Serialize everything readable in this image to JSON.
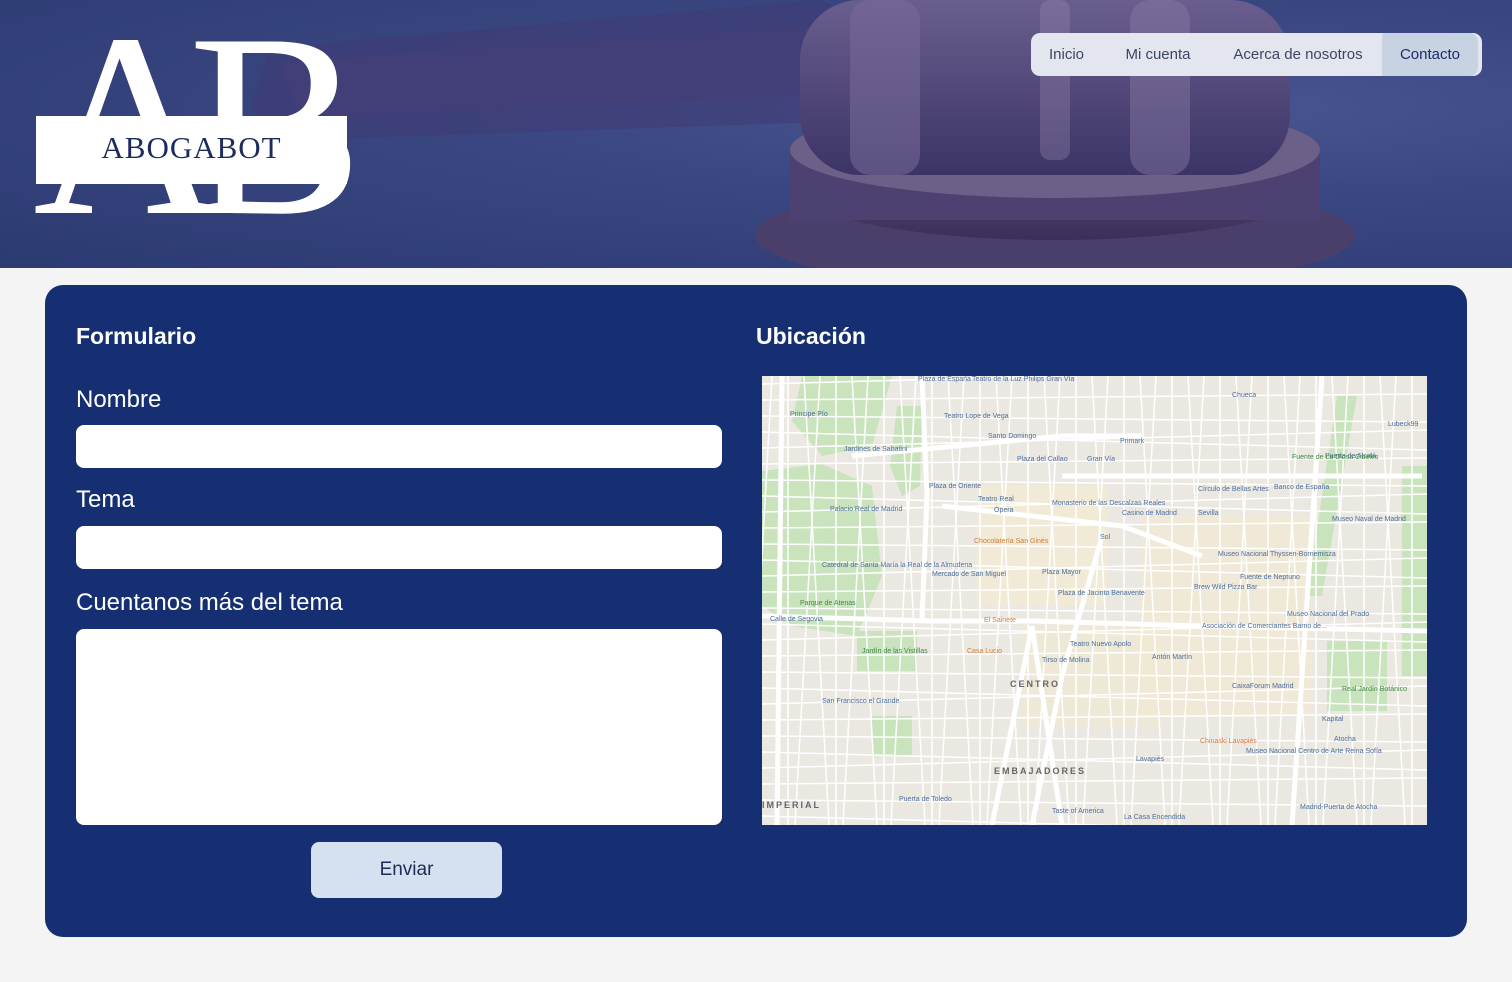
{
  "brand": {
    "monogram": "AB",
    "name": "ABOGABOT"
  },
  "nav": {
    "items": [
      {
        "label": "Inicio"
      },
      {
        "label": "Mi cuenta"
      },
      {
        "label": "Acerca de nosotros"
      },
      {
        "label": "Contacto",
        "active": true
      }
    ]
  },
  "form": {
    "title": "Formulario",
    "name_label": "Nombre",
    "name_value": "",
    "topic_label": "Tema",
    "topic_value": "",
    "details_label": "Cuentanos más del tema",
    "details_value": "",
    "submit_label": "Enviar"
  },
  "location": {
    "title": "Ubicación",
    "map_labels": [
      "Plaza de España",
      "Teatro de la Luz Philips Gran Vía",
      "Principe Pío",
      "Teatro Lope de Vega",
      "Santo Domingo",
      "Jardines de Sabatini",
      "Plaza del Callao",
      "Gran Vía",
      "Primark",
      "Chueca",
      "Lubeck99",
      "Puerta de Alcalá",
      "Fuente de La Diosa Cibeles",
      "Plaza de Oriente",
      "Teatro Real",
      "Ópera",
      "Palacio Real de Madrid",
      "Monasterio de las Descalzas Reales",
      "Casino de Madrid",
      "Sevilla",
      "Círculo de Bellas Artes",
      "Banco de España",
      "Museo Naval de Madrid",
      "Chocolatería San Ginés",
      "Sol",
      "Catedral de Santa María la Real de la Almudena",
      "Mercado de San Miguel",
      "Plaza Mayor",
      "Museo Nacional Thyssen-Bornemisza",
      "Fuente de Neptuno",
      "Brew Wild Pizza Bar",
      "Parque de Atenas",
      "Plaza de Jacinto Benavente",
      "El Sainete",
      "Museo Nacional del Prado",
      "Asociación de Comerciantes Barrio de...",
      "Jardín de las Vistillas",
      "Casa Lucio",
      "Teatro Nuevo Apolo",
      "Tirso de Molina",
      "Antón Martín",
      "CENTRO",
      "CaixaForum Madrid",
      "Real Jardín Botánico",
      "San Francisco el Grande",
      "Kapital",
      "Atocha",
      "Chinaski Lavapiés",
      "Museo Nacional Centro de Arte Reina Sofía",
      "Lavapiés",
      "EMBAJADORES",
      "Puerta de Toledo",
      "Taste of America",
      "La Casa Encendida",
      "Madrid-Puerta de Atocha",
      "IMPERIAL",
      "Calle de Segovia"
    ]
  },
  "colors": {
    "card_bg": "#162f72",
    "page_bg": "#f4f4f4",
    "button_bg": "#d5e1ef",
    "nav_active_bg": "#c7d2e3"
  }
}
